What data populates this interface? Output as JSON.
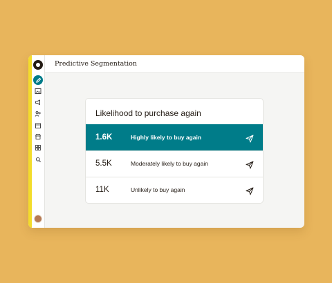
{
  "app": {
    "page_title": "Predictive Segmentation",
    "brand_color": "#007C89",
    "accent_strip_color": "#F3DC2B",
    "background_color": "#E8B55C"
  },
  "sidebar": {
    "items": [
      {
        "icon": "pencil-icon",
        "active": true
      },
      {
        "icon": "image-icon",
        "active": false
      },
      {
        "icon": "megaphone-icon",
        "active": false
      },
      {
        "icon": "people-icon",
        "active": false
      },
      {
        "icon": "calendar-icon",
        "active": false
      },
      {
        "icon": "store-icon",
        "active": false
      },
      {
        "icon": "grid-icon",
        "active": false
      },
      {
        "icon": "search-icon",
        "active": false
      }
    ]
  },
  "card": {
    "title": "Likelihood to purchase again",
    "rows": [
      {
        "count": "1.6K",
        "label": "Highly likely to buy again",
        "highlighted": true
      },
      {
        "count": "5.5K",
        "label": "Moderately likely to buy again",
        "highlighted": false
      },
      {
        "count": "11K",
        "label": "Unlikely to buy again",
        "highlighted": false
      }
    ]
  }
}
